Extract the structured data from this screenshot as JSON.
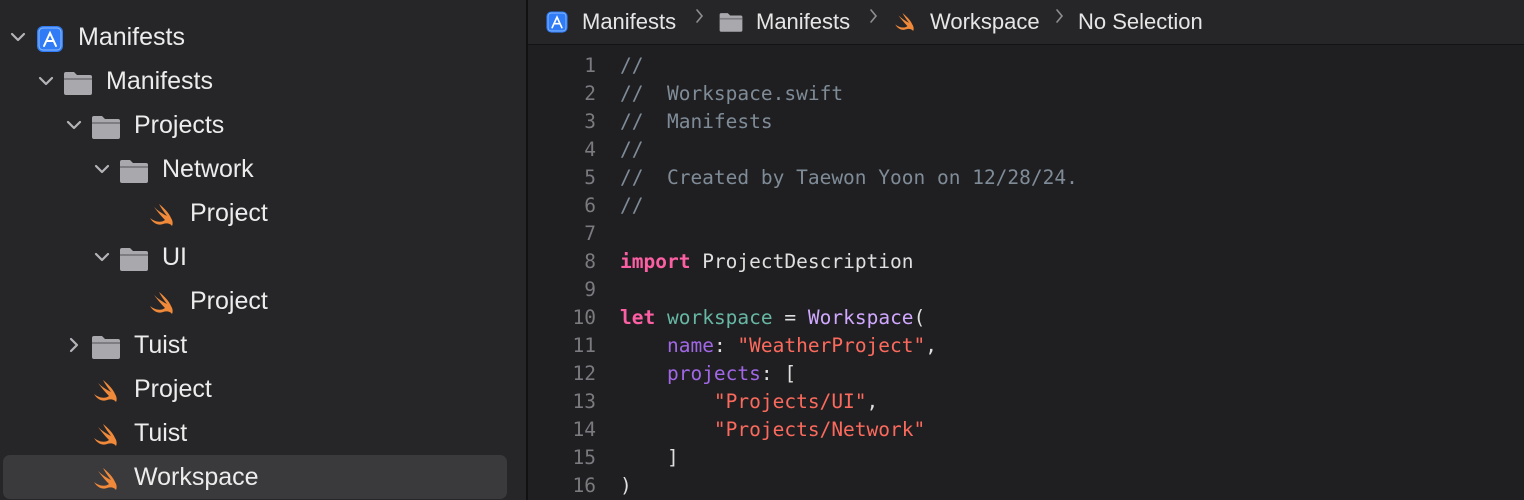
{
  "colors": {
    "navigator_bg": "#262628",
    "editor_bg": "#1f1f21",
    "selection_bg": "#3a3a3c",
    "folder": "#a9a9ad",
    "swift": "#f0893a",
    "app_icon": "#2f7cf6",
    "comment": "#7f8c98",
    "keyword": "#fc5fa3",
    "string": "#fc6a5d",
    "type": "#d0a8ff",
    "identifier": "#67b7a4",
    "label": "#a167e6"
  },
  "navigator": {
    "items": [
      {
        "label": "Manifests",
        "icon": "app-project-icon",
        "indent": 0,
        "disclosure": "expanded",
        "selected": false
      },
      {
        "label": "Manifests",
        "icon": "folder-icon",
        "indent": 1,
        "disclosure": "expanded",
        "selected": false
      },
      {
        "label": "Projects",
        "icon": "folder-icon",
        "indent": 2,
        "disclosure": "expanded",
        "selected": false
      },
      {
        "label": "Network",
        "icon": "folder-icon",
        "indent": 3,
        "disclosure": "expanded",
        "selected": false
      },
      {
        "label": "Project",
        "icon": "swift-file-icon",
        "indent": 4,
        "disclosure": "none",
        "selected": false
      },
      {
        "label": "UI",
        "icon": "folder-icon",
        "indent": 3,
        "disclosure": "expanded",
        "selected": false
      },
      {
        "label": "Project",
        "icon": "swift-file-icon",
        "indent": 4,
        "disclosure": "none",
        "selected": false
      },
      {
        "label": "Tuist",
        "icon": "folder-icon",
        "indent": 2,
        "disclosure": "collapsed",
        "selected": false
      },
      {
        "label": "Project",
        "icon": "swift-file-icon",
        "indent": 2,
        "disclosure": "none",
        "selected": false
      },
      {
        "label": "Tuist",
        "icon": "swift-file-icon",
        "indent": 2,
        "disclosure": "none",
        "selected": false
      },
      {
        "label": "Workspace",
        "icon": "swift-file-icon",
        "indent": 2,
        "disclosure": "none",
        "selected": true
      }
    ]
  },
  "jumpbar": {
    "crumbs": [
      {
        "label": "Manifests",
        "icon": "app-project-icon"
      },
      {
        "label": "Manifests",
        "icon": "folder-icon"
      },
      {
        "label": "Workspace",
        "icon": "swift-file-icon"
      },
      {
        "label": "No Selection",
        "icon": ""
      }
    ]
  },
  "editor": {
    "lines": [
      {
        "n": "1",
        "tokens": [
          {
            "t": "//",
            "k": "comment"
          }
        ]
      },
      {
        "n": "2",
        "tokens": [
          {
            "t": "//  Workspace.swift",
            "k": "comment"
          }
        ]
      },
      {
        "n": "3",
        "tokens": [
          {
            "t": "//  Manifests",
            "k": "comment"
          }
        ]
      },
      {
        "n": "4",
        "tokens": [
          {
            "t": "//",
            "k": "comment"
          }
        ]
      },
      {
        "n": "5",
        "tokens": [
          {
            "t": "//  Created by Taewon Yoon on 12/28/24.",
            "k": "comment"
          }
        ]
      },
      {
        "n": "6",
        "tokens": [
          {
            "t": "//",
            "k": "comment"
          }
        ]
      },
      {
        "n": "7",
        "tokens": []
      },
      {
        "n": "8",
        "tokens": [
          {
            "t": "import",
            "k": "keyword"
          },
          {
            "t": " ProjectDescription",
            "k": "plain"
          }
        ]
      },
      {
        "n": "9",
        "tokens": []
      },
      {
        "n": "10",
        "tokens": [
          {
            "t": "let",
            "k": "keyword"
          },
          {
            "t": " ",
            "k": "plain"
          },
          {
            "t": "workspace",
            "k": "ident"
          },
          {
            "t": " = ",
            "k": "plain"
          },
          {
            "t": "Workspace",
            "k": "type"
          },
          {
            "t": "(",
            "k": "plain"
          }
        ]
      },
      {
        "n": "11",
        "tokens": [
          {
            "t": "    ",
            "k": "plain"
          },
          {
            "t": "name",
            "k": "label"
          },
          {
            "t": ": ",
            "k": "plain"
          },
          {
            "t": "\"WeatherProject\"",
            "k": "string"
          },
          {
            "t": ",",
            "k": "plain"
          }
        ]
      },
      {
        "n": "12",
        "tokens": [
          {
            "t": "    ",
            "k": "plain"
          },
          {
            "t": "projects",
            "k": "label"
          },
          {
            "t": ": [",
            "k": "plain"
          }
        ]
      },
      {
        "n": "13",
        "tokens": [
          {
            "t": "        ",
            "k": "plain"
          },
          {
            "t": "\"Projects/UI\"",
            "k": "string"
          },
          {
            "t": ",",
            "k": "plain"
          }
        ]
      },
      {
        "n": "14",
        "tokens": [
          {
            "t": "        ",
            "k": "plain"
          },
          {
            "t": "\"Projects/Network\"",
            "k": "string"
          }
        ]
      },
      {
        "n": "15",
        "tokens": [
          {
            "t": "    ]",
            "k": "plain"
          }
        ]
      },
      {
        "n": "16",
        "tokens": [
          {
            "t": ")",
            "k": "plain"
          }
        ]
      }
    ]
  }
}
